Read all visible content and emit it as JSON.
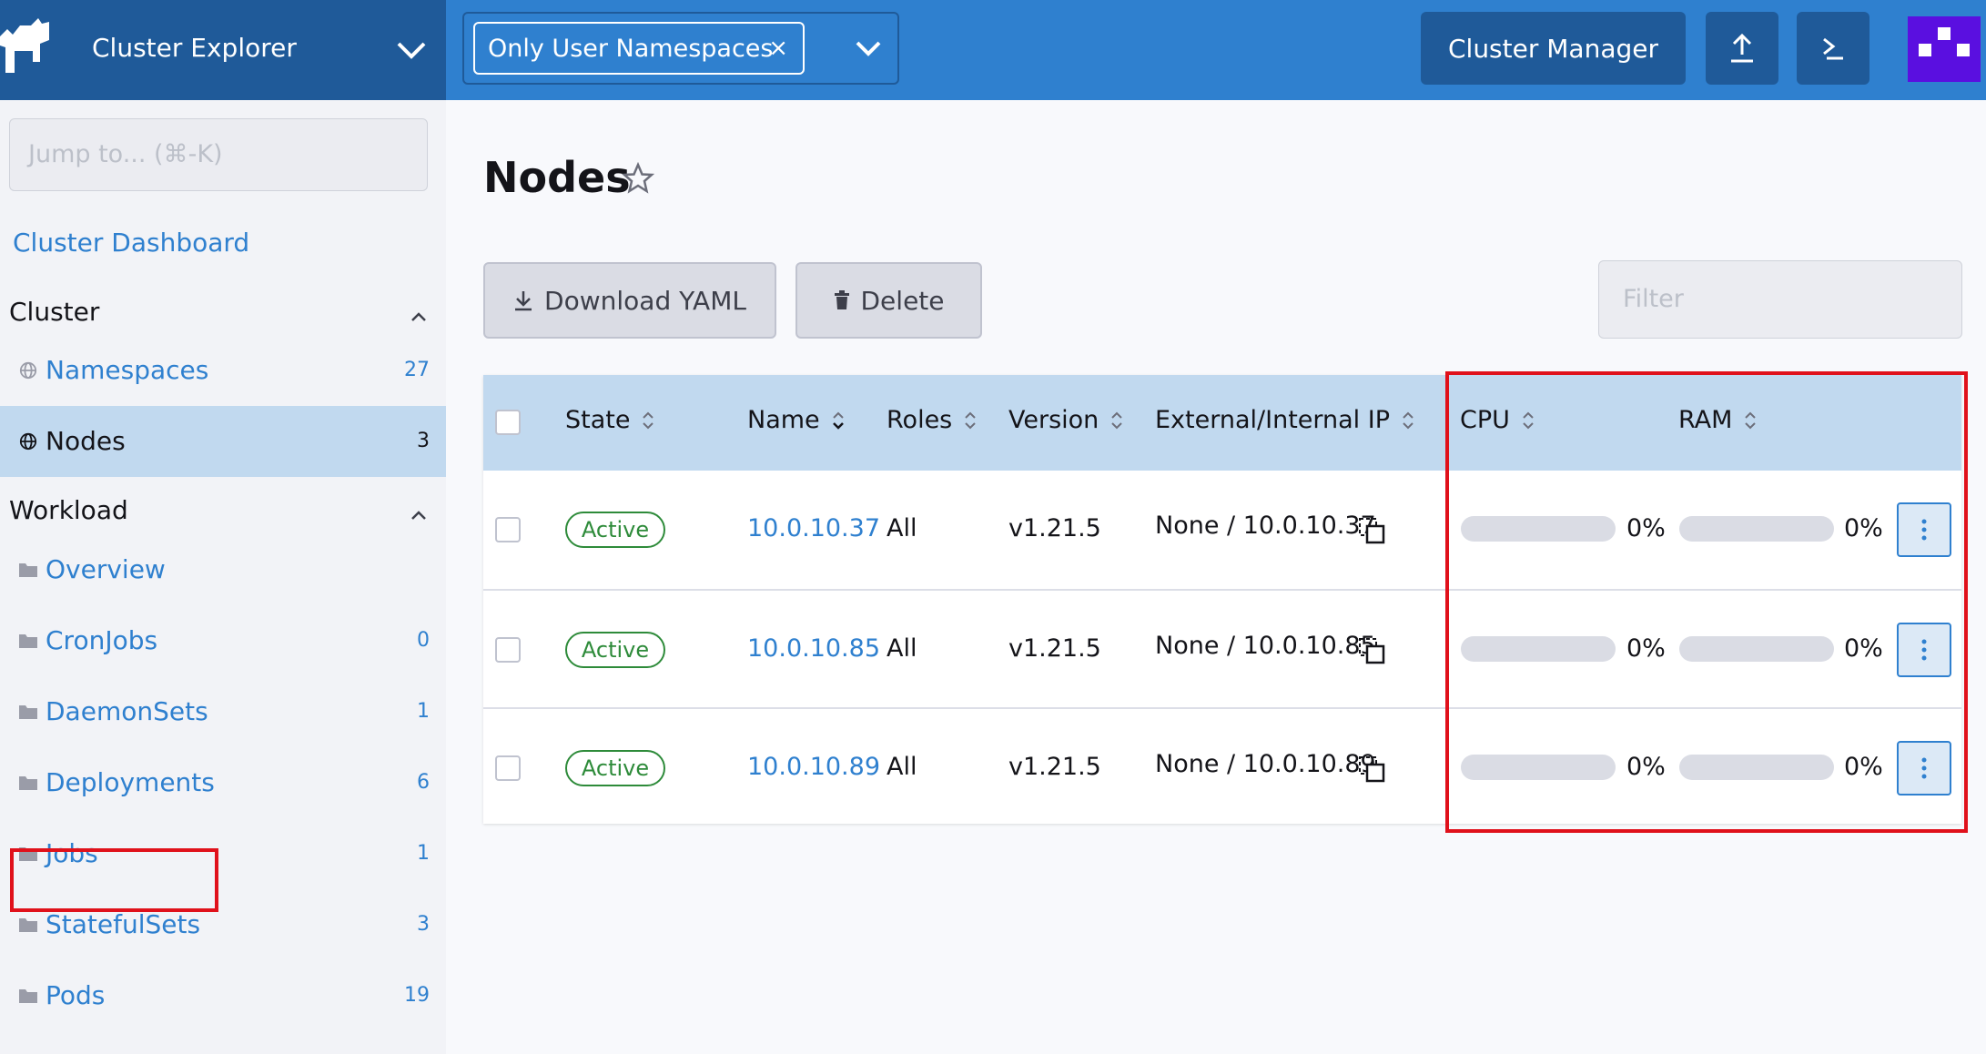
{
  "header": {
    "cluster_title": "Cluster Explorer",
    "namespace_chip": "Only User Namespaces",
    "namespace_chip_remove": "×",
    "cluster_manager_label": "Cluster Manager",
    "brand_color": "#2f80cf",
    "dark_color": "#1f5a99"
  },
  "sidebar": {
    "jump_placeholder": "Jump to... (⌘-K)",
    "dashboard_link": "Cluster Dashboard",
    "groups": [
      {
        "label": "Cluster",
        "items": [
          {
            "label": "Namespaces",
            "count": "27",
            "icon": "globe-icon"
          },
          {
            "label": "Nodes",
            "count": "3",
            "icon": "globe-icon",
            "active": true
          }
        ]
      },
      {
        "label": "Workload",
        "items": [
          {
            "label": "Overview",
            "count": "",
            "icon": "folder-icon"
          },
          {
            "label": "CronJobs",
            "count": "0",
            "icon": "folder-icon"
          },
          {
            "label": "DaemonSets",
            "count": "1",
            "icon": "folder-icon"
          },
          {
            "label": "Deployments",
            "count": "6",
            "icon": "folder-icon"
          },
          {
            "label": "Jobs",
            "count": "1",
            "icon": "folder-icon"
          },
          {
            "label": "StatefulSets",
            "count": "3",
            "icon": "folder-icon"
          },
          {
            "label": "Pods",
            "count": "19",
            "icon": "folder-icon"
          }
        ]
      }
    ]
  },
  "main": {
    "title": "Nodes",
    "download_yaml_label": "Download YAML",
    "delete_label": "Delete",
    "filter_placeholder": "Filter",
    "columns": [
      "State",
      "Name",
      "Roles",
      "Version",
      "External/Internal IP",
      "CPU",
      "RAM"
    ],
    "rows": [
      {
        "state": "Active",
        "name": "10.0.10.37",
        "roles": "All",
        "version": "v1.21.5",
        "ip": "None / 10.0.10.37",
        "cpu": "0%",
        "cpu_value": 0,
        "ram": "0%",
        "ram_value": 0
      },
      {
        "state": "Active",
        "name": "10.0.10.85",
        "roles": "All",
        "version": "v1.21.5",
        "ip": "None / 10.0.10.85",
        "cpu": "0%",
        "cpu_value": 0,
        "ram": "0%",
        "ram_value": 0
      },
      {
        "state": "Active",
        "name": "10.0.10.89",
        "roles": "All",
        "version": "v1.21.5",
        "ip": "None / 10.0.10.89",
        "cpu": "0%",
        "cpu_value": 0,
        "ram": "0%",
        "ram_value": 0
      }
    ],
    "status_color": "#2e8b3a",
    "highlight_color": "#e0111b"
  }
}
